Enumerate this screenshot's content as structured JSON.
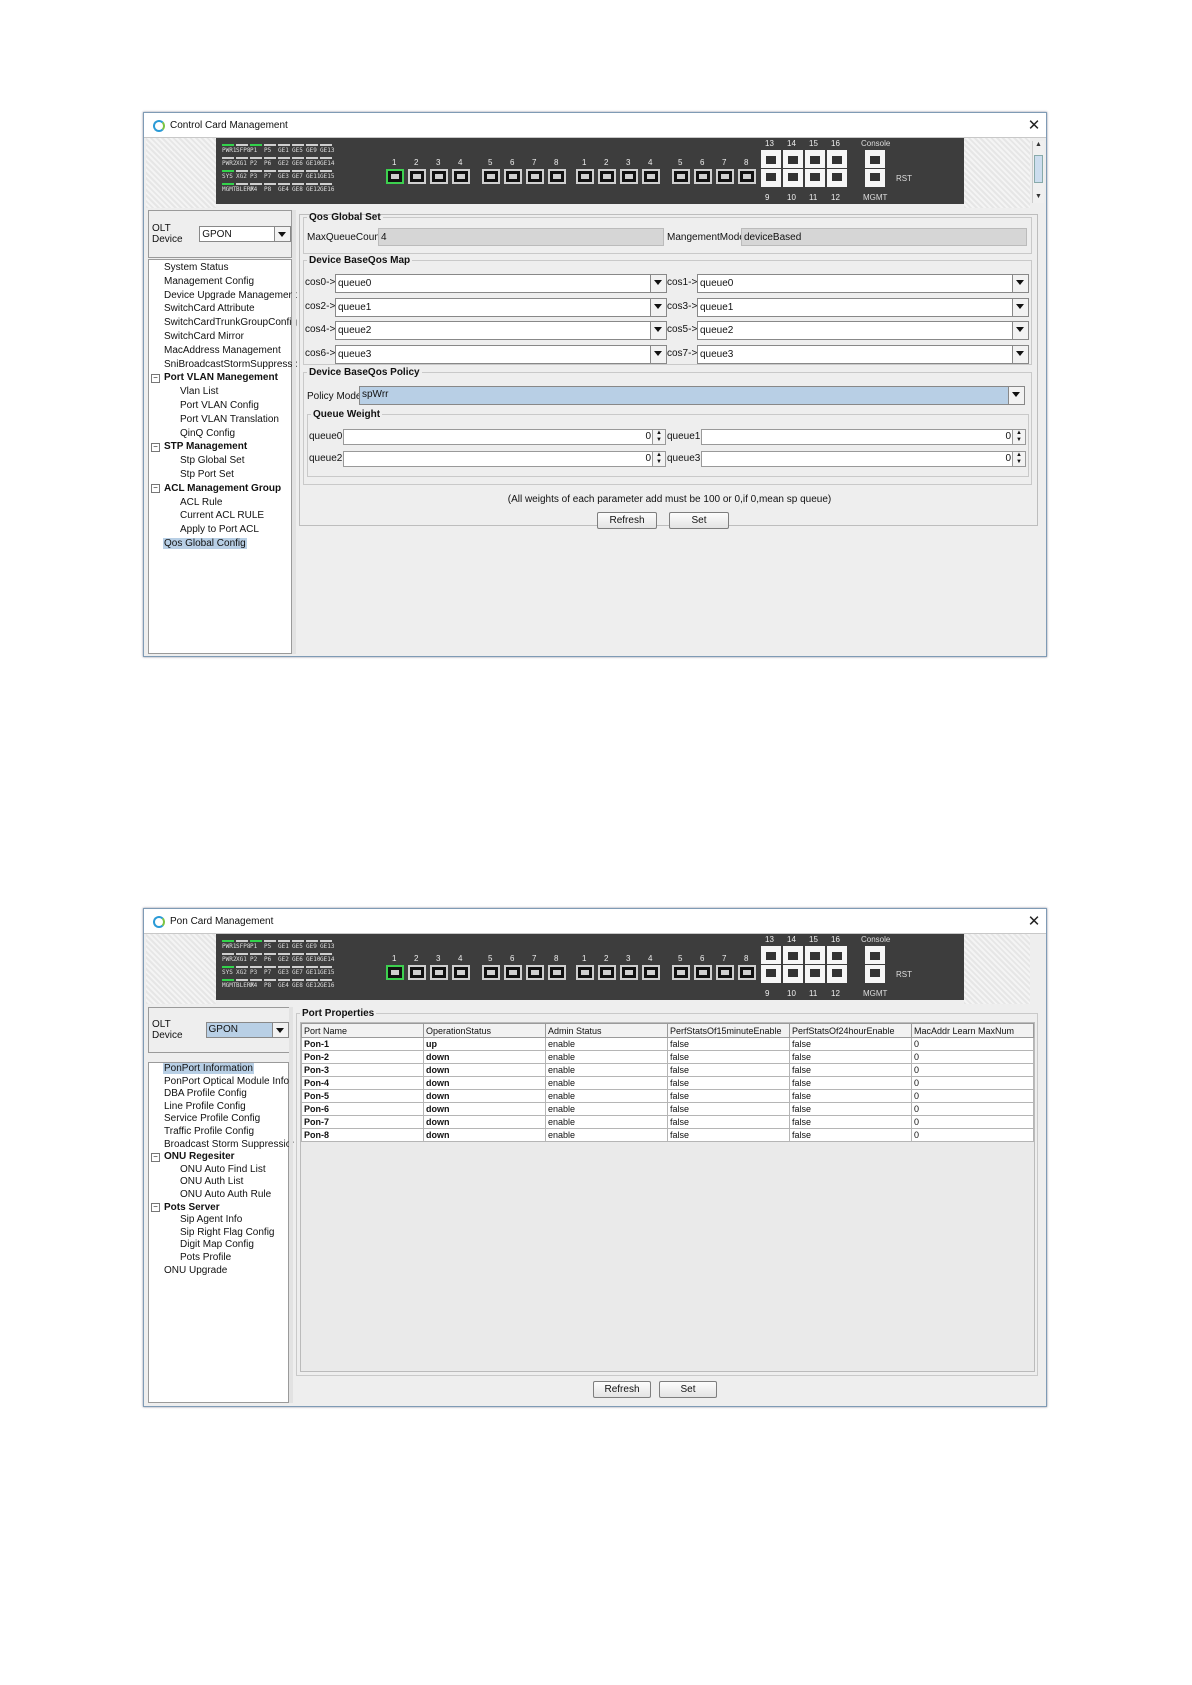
{
  "window1": {
    "title": "Control Card Management",
    "leds": [
      {
        "label": "PWR1",
        "on": true
      },
      {
        "label": "SFP8",
        "on": false
      },
      {
        "label": "P1",
        "on": true
      },
      {
        "label": "P5",
        "on": false
      },
      {
        "label": "GE1",
        "on": false
      },
      {
        "label": "GE5",
        "on": false
      },
      {
        "label": "GE9",
        "on": false
      },
      {
        "label": "GE13",
        "on": false
      },
      {
        "label": "PWR2",
        "on": false
      },
      {
        "label": "XG1",
        "on": false
      },
      {
        "label": "P2",
        "on": false
      },
      {
        "label": "P6",
        "on": false
      },
      {
        "label": "GE2",
        "on": false
      },
      {
        "label": "GE6",
        "on": false
      },
      {
        "label": "GE10",
        "on": false
      },
      {
        "label": "GE14",
        "on": false
      },
      {
        "label": "SYS",
        "on": true
      },
      {
        "label": "XG2",
        "on": false
      },
      {
        "label": "P3",
        "on": false
      },
      {
        "label": "P7",
        "on": false
      },
      {
        "label": "GE3",
        "on": false
      },
      {
        "label": "GE7",
        "on": false
      },
      {
        "label": "GE11",
        "on": false
      },
      {
        "label": "GE15",
        "on": false
      },
      {
        "label": "MGMT",
        "on": true
      },
      {
        "label": "BLERX",
        "on": false
      },
      {
        "label": "P4",
        "on": false
      },
      {
        "label": "P8",
        "on": false
      },
      {
        "label": "GE4",
        "on": false
      },
      {
        "label": "GE8",
        "on": false
      },
      {
        "label": "GE12",
        "on": false
      },
      {
        "label": "GE16",
        "on": false
      }
    ],
    "pon_ports": [
      "1",
      "2",
      "3",
      "4",
      "5",
      "6",
      "7",
      "8"
    ],
    "ge_ports": [
      "1",
      "2",
      "3",
      "4",
      "5",
      "6",
      "7",
      "8"
    ],
    "rj_top": [
      "13",
      "14",
      "15",
      "16"
    ],
    "rj_bottom": [
      "9",
      "10",
      "11",
      "12"
    ],
    "console_label": "Console",
    "mgmt_label": "MGMT",
    "rst_label": "RST",
    "olt_label": "OLT Device",
    "olt_value": "GPON",
    "tree": [
      {
        "label": "System Status",
        "level": 1
      },
      {
        "label": "Management Config",
        "level": 1
      },
      {
        "label": "Device Upgrade Management",
        "level": 1
      },
      {
        "label": "SwitchCard Attribute",
        "level": 1
      },
      {
        "label": "SwitchCardTrunkGroupConfig",
        "level": 1
      },
      {
        "label": "SwitchCard Mirror",
        "level": 1
      },
      {
        "label": "MacAddress Management",
        "level": 1
      },
      {
        "label": "SniBroadcastStormSuppressio",
        "level": 1
      },
      {
        "label": "Port VLAN Manegement",
        "level": 0,
        "expander": "-"
      },
      {
        "label": "Vlan List",
        "level": 2
      },
      {
        "label": "Port VLAN Config",
        "level": 2
      },
      {
        "label": "Port VLAN Translation",
        "level": 2
      },
      {
        "label": "QinQ Config",
        "level": 2
      },
      {
        "label": "STP Management",
        "level": 0,
        "expander": "-"
      },
      {
        "label": "Stp Global Set",
        "level": 2
      },
      {
        "label": "Stp Port Set",
        "level": 2
      },
      {
        "label": "ACL Management Group",
        "level": 0,
        "expander": "-"
      },
      {
        "label": "ACL Rule",
        "level": 2
      },
      {
        "label": "Current ACL RULE",
        "level": 2
      },
      {
        "label": "Apply to Port ACL",
        "level": 2
      },
      {
        "label": "Qos Global Config",
        "level": 1,
        "selected": true
      }
    ],
    "qos_global": {
      "legend": "Qos Global Set",
      "max_queue_label": "MaxQueueCount",
      "max_queue_value": "4",
      "mode_label": "MangementMode",
      "mode_value": "deviceBased"
    },
    "qos_map": {
      "legend": "Device BaseQos Map",
      "rows": [
        {
          "cos": "cos0->",
          "queue": "queue0"
        },
        {
          "cos": "cos1->",
          "queue": "queue0"
        },
        {
          "cos": "cos2->",
          "queue": "queue1"
        },
        {
          "cos": "cos3->",
          "queue": "queue1"
        },
        {
          "cos": "cos4->",
          "queue": "queue2"
        },
        {
          "cos": "cos5->",
          "queue": "queue2"
        },
        {
          "cos": "cos6->",
          "queue": "queue3"
        },
        {
          "cos": "cos7->",
          "queue": "queue3"
        }
      ]
    },
    "qos_policy": {
      "legend": "Device BaseQos Policy",
      "mode_label": "Policy Mode",
      "mode_value": "spWrr"
    },
    "queue_weight": {
      "legend": "Queue Weight",
      "queues": [
        {
          "label": "queue0",
          "value": "0"
        },
        {
          "label": "queue1",
          "value": "0"
        },
        {
          "label": "queue2",
          "value": "0"
        },
        {
          "label": "queue3",
          "value": "0"
        }
      ]
    },
    "note": "(All weights of each parameter add must be 100 or 0,if 0,mean sp queue)",
    "refresh_label": "Refresh",
    "set_label": "Set"
  },
  "window2": {
    "title": "Pon Card Management",
    "leds": [
      {
        "label": "PWR1",
        "on": true
      },
      {
        "label": "SFP8",
        "on": false
      },
      {
        "label": "P1",
        "on": true
      },
      {
        "label": "P5",
        "on": false
      },
      {
        "label": "GE1",
        "on": false
      },
      {
        "label": "GE5",
        "on": false
      },
      {
        "label": "GE9",
        "on": false
      },
      {
        "label": "GE13",
        "on": false
      },
      {
        "label": "PWR2",
        "on": false
      },
      {
        "label": "XG1",
        "on": false
      },
      {
        "label": "P2",
        "on": false
      },
      {
        "label": "P6",
        "on": false
      },
      {
        "label": "GE2",
        "on": false
      },
      {
        "label": "GE6",
        "on": false
      },
      {
        "label": "GE10",
        "on": false
      },
      {
        "label": "GE14",
        "on": false
      },
      {
        "label": "SYS",
        "on": true
      },
      {
        "label": "XG2",
        "on": false
      },
      {
        "label": "P3",
        "on": false
      },
      {
        "label": "P7",
        "on": false
      },
      {
        "label": "GE3",
        "on": false
      },
      {
        "label": "GE7",
        "on": false
      },
      {
        "label": "GE11",
        "on": false
      },
      {
        "label": "GE15",
        "on": false
      },
      {
        "label": "MGMT",
        "on": true
      },
      {
        "label": "BLERX",
        "on": false
      },
      {
        "label": "P4",
        "on": false
      },
      {
        "label": "P8",
        "on": false
      },
      {
        "label": "GE4",
        "on": false
      },
      {
        "label": "GE8",
        "on": false
      },
      {
        "label": "GE12",
        "on": false
      },
      {
        "label": "GE16",
        "on": false
      }
    ],
    "pon_ports": [
      "1",
      "2",
      "3",
      "4",
      "5",
      "6",
      "7",
      "8"
    ],
    "ge_ports": [
      "1",
      "2",
      "3",
      "4",
      "5",
      "6",
      "7",
      "8"
    ],
    "rj_top": [
      "13",
      "14",
      "15",
      "16"
    ],
    "rj_bottom": [
      "9",
      "10",
      "11",
      "12"
    ],
    "console_label": "Console",
    "mgmt_label": "MGMT",
    "rst_label": "RST",
    "olt_label": "OLT Device",
    "olt_value": "GPON",
    "tree": [
      {
        "label": "PonPort Information",
        "level": 1,
        "selected": true
      },
      {
        "label": "PonPort Optical Module Info",
        "level": 1
      },
      {
        "label": "DBA Profile Config",
        "level": 1
      },
      {
        "label": "Line Profile Config",
        "level": 1
      },
      {
        "label": "Service Profile Config",
        "level": 1
      },
      {
        "label": "Traffic Profile Config",
        "level": 1
      },
      {
        "label": "Broadcast Storm Suppression",
        "level": 1
      },
      {
        "label": "ONU Regesiter",
        "level": 0,
        "expander": "-"
      },
      {
        "label": "ONU Auto Find List",
        "level": 2
      },
      {
        "label": "ONU Auth List",
        "level": 2
      },
      {
        "label": "ONU Auto Auth Rule",
        "level": 2
      },
      {
        "label": "Pots Server",
        "level": 0,
        "expander": "-"
      },
      {
        "label": "Sip Agent Info",
        "level": 2
      },
      {
        "label": "Sip Right Flag Config",
        "level": 2
      },
      {
        "label": "Digit Map Config",
        "level": 2
      },
      {
        "label": "Pots Profile",
        "level": 2
      },
      {
        "label": "ONU Upgrade",
        "level": 1
      }
    ],
    "port_properties": {
      "legend": "Port Properties",
      "columns": [
        "Port Name",
        "OperationStatus",
        "Admin Status",
        "PerfStatsOf15minuteEnable",
        "PerfStatsOf24hourEnable",
        "MacAddr Learn MaxNum"
      ],
      "rows": [
        [
          "Pon-1",
          "up",
          "enable",
          "false",
          "false",
          "0"
        ],
        [
          "Pon-2",
          "down",
          "enable",
          "false",
          "false",
          "0"
        ],
        [
          "Pon-3",
          "down",
          "enable",
          "false",
          "false",
          "0"
        ],
        [
          "Pon-4",
          "down",
          "enable",
          "false",
          "false",
          "0"
        ],
        [
          "Pon-5",
          "down",
          "enable",
          "false",
          "false",
          "0"
        ],
        [
          "Pon-6",
          "down",
          "enable",
          "false",
          "false",
          "0"
        ],
        [
          "Pon-7",
          "down",
          "enable",
          "false",
          "false",
          "0"
        ],
        [
          "Pon-8",
          "down",
          "enable",
          "false",
          "false",
          "0"
        ]
      ]
    },
    "refresh_label": "Refresh",
    "set_label": "Set"
  }
}
